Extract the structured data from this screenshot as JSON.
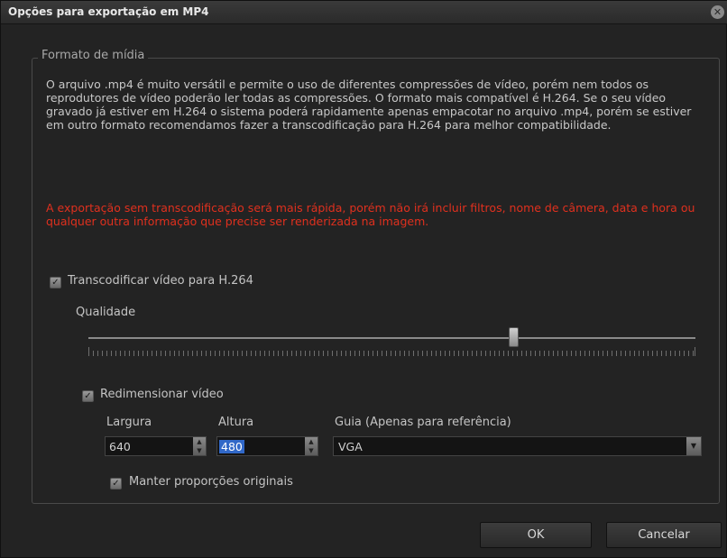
{
  "window": {
    "title": "Opções para exportação em MP4"
  },
  "group": {
    "legend": "Formato de mídia"
  },
  "description": "O arquivo .mp4 é muito versátil e permite o uso de diferentes compressões de vídeo, porém nem todos os reprodutores de vídeo poderão ler todas as compressões. O formato mais compatível é H.264. Se o seu vídeo gravado já estiver em H.264 o sistema poderá rapidamente apenas empacotar no arquivo .mp4, porém se estiver em outro formato recomendamos fazer a transcodificação para H.264 para melhor compatibilidade.",
  "warning": "A exportação sem transcodificação será mais rápida, porém não irá incluir filtros, nome de câmera, data e hora ou qualquer outra informação que precise ser renderizada na imagem.",
  "transcode": {
    "label": "Transcodificar vídeo para H.264",
    "checked": true
  },
  "quality": {
    "label": "Qualidade",
    "level": 0.7
  },
  "resize": {
    "label": "Redimensionar vídeo",
    "checked": true
  },
  "width": {
    "label": "Largura",
    "value": "640"
  },
  "height": {
    "label": "Altura",
    "value": "480"
  },
  "guide": {
    "label": "Guia (Apenas para referência)",
    "value": "VGA"
  },
  "keep_ratio": {
    "label": "Manter proporções originais",
    "checked": true
  },
  "buttons": {
    "ok": "OK",
    "cancel": "Cancelar"
  },
  "colors": {
    "background": "#232323",
    "warning": "#e0301e",
    "selection": "#3168c8"
  }
}
